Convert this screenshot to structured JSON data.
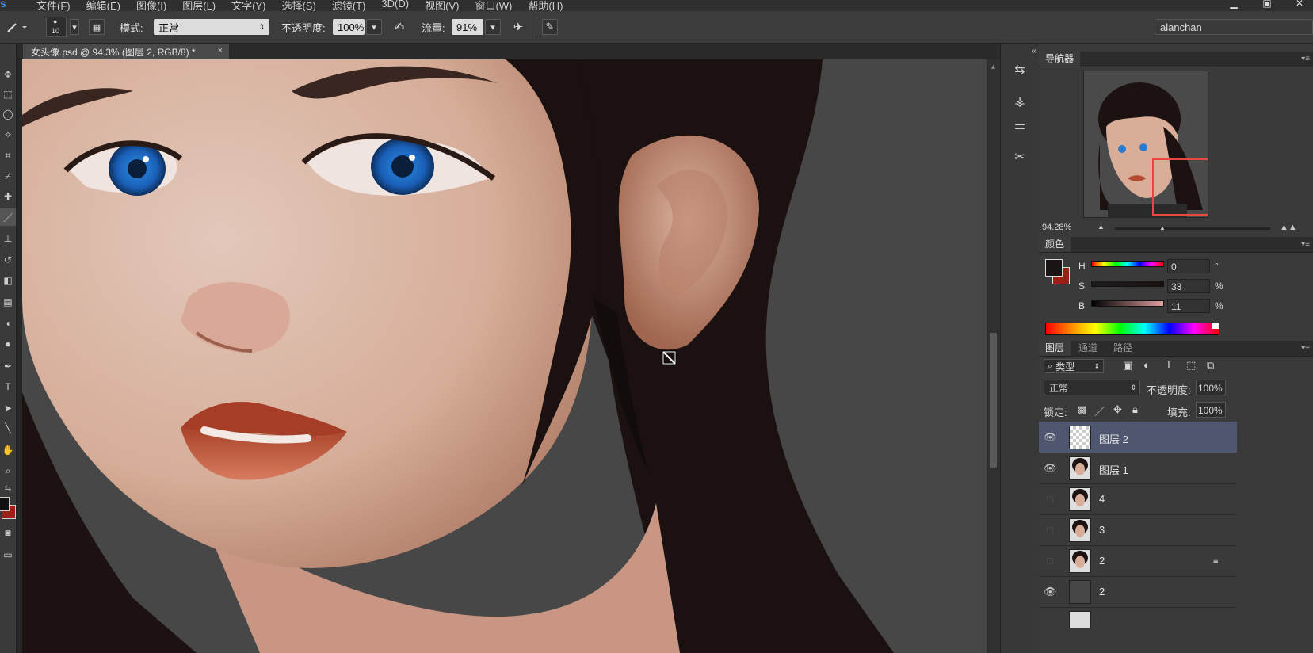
{
  "app": {
    "logo": "s"
  },
  "menu": [
    "文件(F)",
    "编辑(E)",
    "图像(I)",
    "图层(L)",
    "文字(Y)",
    "选择(S)",
    "滤镜(T)",
    "3D(D)",
    "视图(V)",
    "窗口(W)",
    "帮助(H)"
  ],
  "options": {
    "brush_size": "10",
    "mode_label": "模式:",
    "mode_value": "正常",
    "opacity_label": "不透明度:",
    "opacity_value": "100%",
    "flow_label": "流量:",
    "flow_value": "91%",
    "workspace": "alanchan"
  },
  "document": {
    "tab_title": "女头像.psd @ 94.3% (图层 2, RGB/8) *",
    "close": "×"
  },
  "navigator": {
    "tab": "导航器",
    "zoom": "94.28%"
  },
  "color": {
    "tab": "颜色",
    "h_label": "H",
    "h_value": "0",
    "h_unit": "°",
    "s_label": "S",
    "s_value": "33",
    "s_unit": "%",
    "b_label": "B",
    "b_value": "11",
    "b_unit": "%",
    "foreground": "#2b1e1d",
    "background": "#b22a1e"
  },
  "layers_panel": {
    "tabs": [
      "图层",
      "通道",
      "路径"
    ],
    "filter_kind": "类型",
    "blend_mode": "正常",
    "opacity_label": "不透明度:",
    "opacity_value": "100%",
    "lock_label": "锁定:",
    "fill_label": "填充:",
    "fill_value": "100%",
    "layers": [
      {
        "name": "图层 2",
        "visible": true,
        "selected": true,
        "thumb": "transparent"
      },
      {
        "name": "图层 1",
        "visible": true,
        "selected": false,
        "thumb": "face"
      },
      {
        "name": "4",
        "visible": false,
        "selected": false,
        "thumb": "face"
      },
      {
        "name": "3",
        "visible": false,
        "selected": false,
        "thumb": "face"
      },
      {
        "name": "2",
        "visible": false,
        "selected": false,
        "thumb": "face",
        "locked": true
      },
      {
        "name": "2",
        "visible": true,
        "selected": false,
        "thumb": "gray"
      }
    ]
  }
}
